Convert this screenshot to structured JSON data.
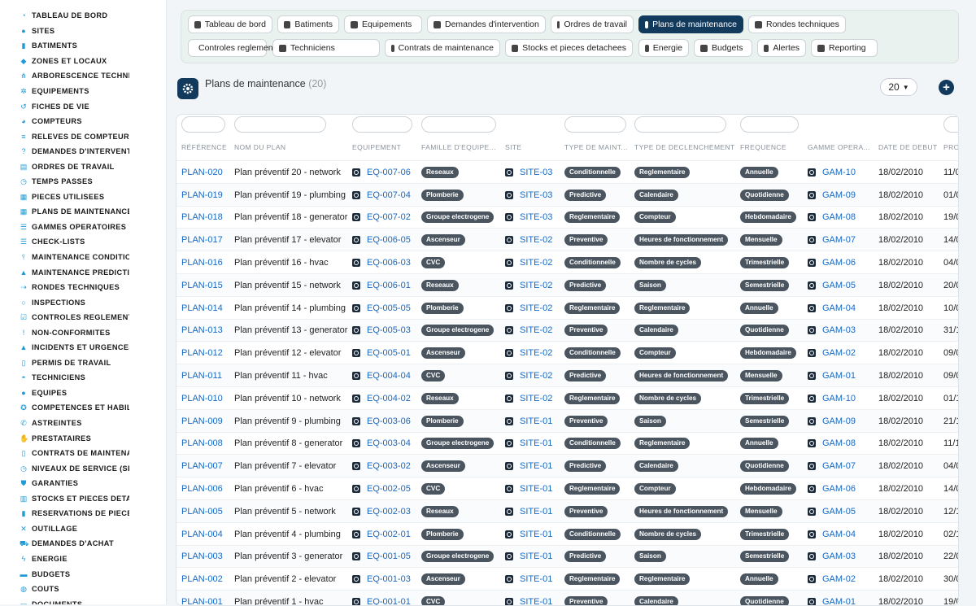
{
  "sidebar": {
    "items": [
      {
        "label": "TABLEAU DE BORD",
        "icon": "dashboard-icon"
      },
      {
        "label": "SITES",
        "icon": "map-pin-icon"
      },
      {
        "label": "BATIMENTS",
        "icon": "building-icon"
      },
      {
        "label": "ZONES ET LOCAUX",
        "icon": "layers-icon"
      },
      {
        "label": "ARBORESCENCE TECHNI",
        "icon": "tree-icon"
      },
      {
        "label": "EQUIPEMENTS",
        "icon": "gears-icon"
      },
      {
        "label": "FICHES DE VIE",
        "icon": "history-icon"
      },
      {
        "label": "COMPTEURS",
        "icon": "gauge-icon"
      },
      {
        "label": "RELEVES DE COMPTEUR:",
        "icon": "list-icon"
      },
      {
        "label": "DEMANDES D'INTERVENT",
        "icon": "question-icon"
      },
      {
        "label": "ORDRES DE TRAVAIL",
        "icon": "clipboard-icon"
      },
      {
        "label": "TEMPS PASSES",
        "icon": "clock-icon"
      },
      {
        "label": "PIECES UTILISEES",
        "icon": "boxes-icon"
      },
      {
        "label": "PLANS DE MAINTENANCE",
        "icon": "calendar-icon"
      },
      {
        "label": "GAMMES OPERATOIRES",
        "icon": "list-ul-icon"
      },
      {
        "label": "CHECK-LISTS",
        "icon": "checklist-icon"
      },
      {
        "label": "MAINTENANCE CONDITIO",
        "icon": "thermometer-icon"
      },
      {
        "label": "MAINTENANCE PREDICTI",
        "icon": "chart-icon"
      },
      {
        "label": "RONDES TECHNIQUES",
        "icon": "route-icon"
      },
      {
        "label": "INSPECTIONS",
        "icon": "search-icon"
      },
      {
        "label": "CONTROLES REGLEMENT",
        "icon": "check-square-icon"
      },
      {
        "label": "NON-CONFORMITES",
        "icon": "exclamation-icon"
      },
      {
        "label": "INCIDENTS ET URGENCES",
        "icon": "warning-icon"
      },
      {
        "label": "PERMIS DE TRAVAIL",
        "icon": "file-icon"
      },
      {
        "label": "TECHNICIENS",
        "icon": "hard-hat-icon"
      },
      {
        "label": "EQUIPES",
        "icon": "users-icon"
      },
      {
        "label": "COMPETENCES ET HABIL",
        "icon": "certificate-icon"
      },
      {
        "label": "ASTREINTES",
        "icon": "phone-icon"
      },
      {
        "label": "PRESTATAIRES",
        "icon": "handshake-icon"
      },
      {
        "label": "CONTRATS DE MAINTENA",
        "icon": "file-contract-icon"
      },
      {
        "label": "NIVEAUX DE SERVICE (SL",
        "icon": "stopwatch-icon"
      },
      {
        "label": "GARANTIES",
        "icon": "shield-icon"
      },
      {
        "label": "STOCKS ET PIECES DETA",
        "icon": "warehouse-icon"
      },
      {
        "label": "RESERVATIONS DE PIECE",
        "icon": "bookmark-icon"
      },
      {
        "label": "OUTILLAGE",
        "icon": "tools-icon"
      },
      {
        "label": "DEMANDES D'ACHAT",
        "icon": "cart-icon"
      },
      {
        "label": "ENERGIE",
        "icon": "bolt-icon"
      },
      {
        "label": "BUDGETS",
        "icon": "money-icon"
      },
      {
        "label": "COUTS",
        "icon": "coins-icon"
      },
      {
        "label": "DOCUMENTS",
        "icon": "folder-icon"
      }
    ]
  },
  "quicknav": {
    "row1": [
      "Tableau de bord",
      "Batiments",
      "Equipements",
      "Demandes d'intervention",
      "Ordres de travail",
      "Plans de maintenance",
      "Rondes techniques"
    ],
    "row2": [
      "Controles reglementaires",
      "Techniciens",
      "Contrats de maintenance",
      "Stocks et pieces detachees",
      "Energie",
      "Budgets",
      "Alertes",
      "Reporting"
    ],
    "active": "Plans de maintenance"
  },
  "header": {
    "title": "Plans de maintenance",
    "count": "(20)",
    "page_size": "20",
    "add_icon": "plus-circle-icon"
  },
  "table": {
    "columns": [
      "RÉFÉRENCE",
      "NOM DU PLAN",
      "EQUIPEMENT",
      "FAMILLE D'EQUIPE...",
      "SITE",
      "TYPE DE MAINT...",
      "TYPE DE DECLENCHEMENT",
      "FREQUENCE",
      "GAMME OPERA...",
      "DATE DE DEBUT",
      "PRO"
    ],
    "rows": [
      {
        "ref": "PLAN-020",
        "name": "Plan préventif 20 - network",
        "eq": "EQ-007-06",
        "fam": "Reseaux",
        "site": "SITE-03",
        "type": "Conditionnelle",
        "trig": "Reglementaire",
        "freq": "Annuelle",
        "gamme": "GAM-10",
        "start": "18/02/2010",
        "next": "11/0"
      },
      {
        "ref": "PLAN-019",
        "name": "Plan préventif 19 - plumbing",
        "eq": "EQ-007-04",
        "fam": "Plomberie",
        "site": "SITE-03",
        "type": "Predictive",
        "trig": "Calendaire",
        "freq": "Quotidienne",
        "gamme": "GAM-09",
        "start": "18/02/2010",
        "next": "01/0"
      },
      {
        "ref": "PLAN-018",
        "name": "Plan préventif 18 - generator",
        "eq": "EQ-007-02",
        "fam": "Groupe electrogene",
        "site": "SITE-03",
        "type": "Reglementaire",
        "trig": "Compteur",
        "freq": "Hebdomadaire",
        "gamme": "GAM-08",
        "start": "18/02/2010",
        "next": "19/0"
      },
      {
        "ref": "PLAN-017",
        "name": "Plan préventif 17 - elevator",
        "eq": "EQ-006-05",
        "fam": "Ascenseur",
        "site": "SITE-02",
        "type": "Preventive",
        "trig": "Heures de fonctionnement",
        "freq": "Mensuelle",
        "gamme": "GAM-07",
        "start": "18/02/2010",
        "next": "14/0"
      },
      {
        "ref": "PLAN-016",
        "name": "Plan préventif 16 - hvac",
        "eq": "EQ-006-03",
        "fam": "CVC",
        "site": "SITE-02",
        "type": "Conditionnelle",
        "trig": "Nombre de cycles",
        "freq": "Trimestrielle",
        "gamme": "GAM-06",
        "start": "18/02/2010",
        "next": "04/0"
      },
      {
        "ref": "PLAN-015",
        "name": "Plan préventif 15 - network",
        "eq": "EQ-006-01",
        "fam": "Reseaux",
        "site": "SITE-02",
        "type": "Predictive",
        "trig": "Saison",
        "freq": "Semestrielle",
        "gamme": "GAM-05",
        "start": "18/02/2010",
        "next": "20/0"
      },
      {
        "ref": "PLAN-014",
        "name": "Plan préventif 14 - plumbing",
        "eq": "EQ-005-05",
        "fam": "Plomberie",
        "site": "SITE-02",
        "type": "Reglementaire",
        "trig": "Reglementaire",
        "freq": "Annuelle",
        "gamme": "GAM-04",
        "start": "18/02/2010",
        "next": "10/0"
      },
      {
        "ref": "PLAN-013",
        "name": "Plan préventif 13 - generator",
        "eq": "EQ-005-03",
        "fam": "Groupe electrogene",
        "site": "SITE-02",
        "type": "Preventive",
        "trig": "Calendaire",
        "freq": "Quotidienne",
        "gamme": "GAM-03",
        "start": "18/02/2010",
        "next": "31/1"
      },
      {
        "ref": "PLAN-012",
        "name": "Plan préventif 12 - elevator",
        "eq": "EQ-005-01",
        "fam": "Ascenseur",
        "site": "SITE-02",
        "type": "Conditionnelle",
        "trig": "Compteur",
        "freq": "Hebdomadaire",
        "gamme": "GAM-02",
        "start": "18/02/2010",
        "next": "09/0"
      },
      {
        "ref": "PLAN-011",
        "name": "Plan préventif 11 - hvac",
        "eq": "EQ-004-04",
        "fam": "CVC",
        "site": "SITE-02",
        "type": "Predictive",
        "trig": "Heures de fonctionnement",
        "freq": "Mensuelle",
        "gamme": "GAM-01",
        "start": "18/02/2010",
        "next": "09/0"
      },
      {
        "ref": "PLAN-010",
        "name": "Plan préventif 10 - network",
        "eq": "EQ-004-02",
        "fam": "Reseaux",
        "site": "SITE-02",
        "type": "Reglementaire",
        "trig": "Nombre de cycles",
        "freq": "Trimestrielle",
        "gamme": "GAM-10",
        "start": "18/02/2010",
        "next": "01/1"
      },
      {
        "ref": "PLAN-009",
        "name": "Plan préventif 9 - plumbing",
        "eq": "EQ-003-06",
        "fam": "Plomberie",
        "site": "SITE-01",
        "type": "Preventive",
        "trig": "Saison",
        "freq": "Semestrielle",
        "gamme": "GAM-09",
        "start": "18/02/2010",
        "next": "21/1"
      },
      {
        "ref": "PLAN-008",
        "name": "Plan préventif 8 - generator",
        "eq": "EQ-003-04",
        "fam": "Groupe electrogene",
        "site": "SITE-01",
        "type": "Conditionnelle",
        "trig": "Reglementaire",
        "freq": "Annuelle",
        "gamme": "GAM-08",
        "start": "18/02/2010",
        "next": "11/1"
      },
      {
        "ref": "PLAN-007",
        "name": "Plan préventif 7 - elevator",
        "eq": "EQ-003-02",
        "fam": "Ascenseur",
        "site": "SITE-01",
        "type": "Predictive",
        "trig": "Calendaire",
        "freq": "Quotidienne",
        "gamme": "GAM-07",
        "start": "18/02/2010",
        "next": "04/0"
      },
      {
        "ref": "PLAN-006",
        "name": "Plan préventif 6 - hvac",
        "eq": "EQ-002-05",
        "fam": "CVC",
        "site": "SITE-01",
        "type": "Reglementaire",
        "trig": "Compteur",
        "freq": "Hebdomadaire",
        "gamme": "GAM-06",
        "start": "18/02/2010",
        "next": "14/0"
      },
      {
        "ref": "PLAN-005",
        "name": "Plan préventif 5 - network",
        "eq": "EQ-002-03",
        "fam": "Reseaux",
        "site": "SITE-01",
        "type": "Preventive",
        "trig": "Heures de fonctionnement",
        "freq": "Mensuelle",
        "gamme": "GAM-05",
        "start": "18/02/2010",
        "next": "12/1"
      },
      {
        "ref": "PLAN-004",
        "name": "Plan préventif 4 - plumbing",
        "eq": "EQ-002-01",
        "fam": "Plomberie",
        "site": "SITE-01",
        "type": "Conditionnelle",
        "trig": "Nombre de cycles",
        "freq": "Trimestrielle",
        "gamme": "GAM-04",
        "start": "18/02/2010",
        "next": "02/1"
      },
      {
        "ref": "PLAN-003",
        "name": "Plan préventif 3 - generator",
        "eq": "EQ-001-05",
        "fam": "Groupe electrogene",
        "site": "SITE-01",
        "type": "Predictive",
        "trig": "Saison",
        "freq": "Semestrielle",
        "gamme": "GAM-03",
        "start": "18/02/2010",
        "next": "22/0"
      },
      {
        "ref": "PLAN-002",
        "name": "Plan préventif 2 - elevator",
        "eq": "EQ-001-03",
        "fam": "Ascenseur",
        "site": "SITE-01",
        "type": "Reglementaire",
        "trig": "Reglementaire",
        "freq": "Annuelle",
        "gamme": "GAM-02",
        "start": "18/02/2010",
        "next": "30/0"
      },
      {
        "ref": "PLAN-001",
        "name": "Plan préventif 1 - hvac",
        "eq": "EQ-001-01",
        "fam": "CVC",
        "site": "SITE-01",
        "type": "Preventive",
        "trig": "Calendaire",
        "freq": "Quotidienne",
        "gamme": "GAM-01",
        "start": "18/02/2010",
        "next": "19/0"
      }
    ]
  },
  "colors": {
    "accent": "#123a5c",
    "link": "#1769c2",
    "badge": "#4a5560",
    "sidebar_icon": "#1e9bd6"
  }
}
